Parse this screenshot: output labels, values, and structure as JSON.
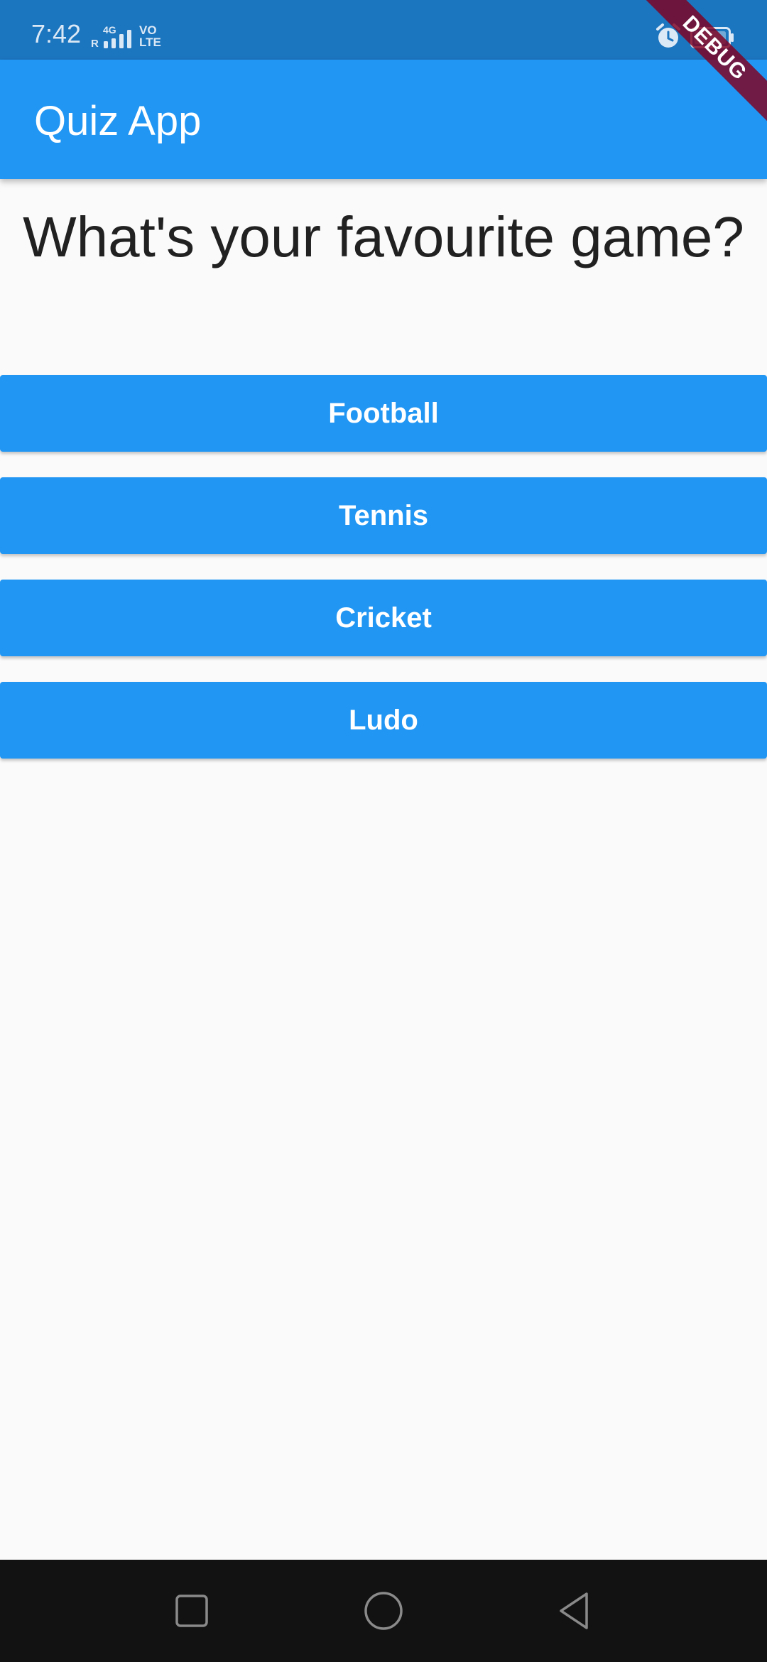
{
  "status_bar": {
    "time": "7:42",
    "network": {
      "top": "4G",
      "roaming": "R",
      "volte_top": "VO",
      "volte_bottom": "LTE"
    },
    "icons": [
      "alarm-icon",
      "battery-icon",
      "signal-icon"
    ]
  },
  "debug_banner": {
    "label": "DEBUG"
  },
  "app_bar": {
    "title": "Quiz App",
    "background": "#2196f3"
  },
  "question": {
    "text": "What's your favourite game?"
  },
  "answers": [
    {
      "label": "Football"
    },
    {
      "label": "Tennis"
    },
    {
      "label": "Cricket"
    },
    {
      "label": "Ludo"
    }
  ],
  "nav_bar": {
    "icons": [
      "recents-icon",
      "home-icon",
      "back-icon"
    ]
  },
  "colors": {
    "accent": "#2196f3",
    "status_bar": "#1c75bf",
    "background": "#fafafa",
    "nav_bar": "#121212",
    "debug_banner": "#800020"
  }
}
